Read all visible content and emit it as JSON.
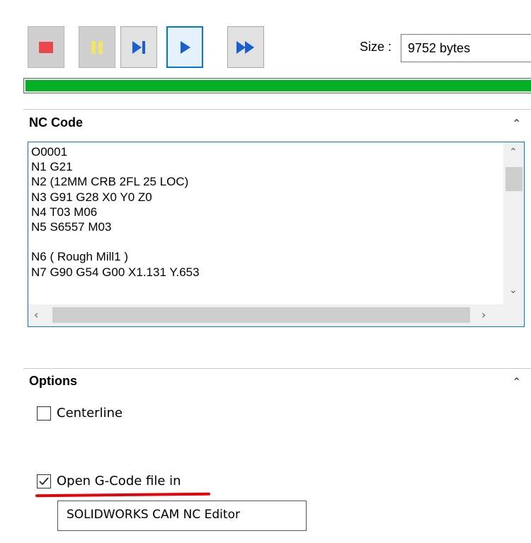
{
  "toolbar": {
    "buttons": [
      {
        "name": "stop",
        "icon": "stop-icon",
        "state": "disabled"
      },
      {
        "name": "pause",
        "icon": "pause-icon",
        "state": "disabled"
      },
      {
        "name": "step",
        "icon": "step-forward-icon",
        "state": "normal"
      },
      {
        "name": "run",
        "icon": "play-icon",
        "state": "active"
      },
      {
        "name": "fast-forward",
        "icon": "fast-forward-icon",
        "state": "normal"
      }
    ],
    "size_label": "Size :",
    "size_value": "9752 bytes"
  },
  "progress": {
    "percent": 100,
    "color": "#06b025"
  },
  "nc_code": {
    "title": "NC Code",
    "lines": [
      "O0001",
      "N1 G21",
      "N2 (12MM CRB 2FL 25 LOC)",
      "N3 G91 G28 X0 Y0 Z0",
      "N4 T03 M06",
      "N5 S6557 M03",
      "",
      "N6 ( Rough Mill1 )",
      "N7 G90 G54 G00 X1.131 Y.653"
    ]
  },
  "options": {
    "title": "Options",
    "centerline": {
      "label": "Centerline",
      "checked": false
    },
    "open_gcode": {
      "label": "Open G-Code file in",
      "checked": true
    },
    "editor_value": "SOLIDWORKS CAM NC Editor"
  },
  "colors": {
    "accent": "#0078d7",
    "stop_icon": "#e8474c",
    "pause_icon": "#f2e566",
    "annotation_underline": "#e8000b"
  }
}
